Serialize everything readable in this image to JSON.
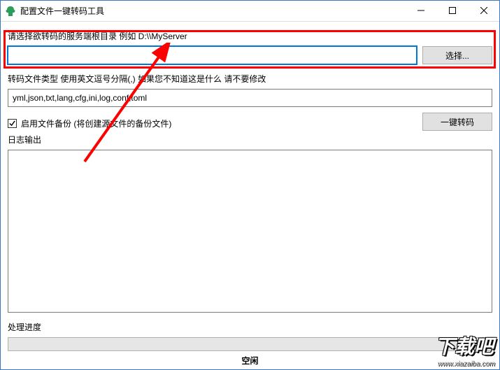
{
  "titlebar": {
    "title": "配置文件一键转码工具",
    "icon_name": "app-icon",
    "icon_color": "#2a9d5a"
  },
  "labels": {
    "root_dir_label": "请选择欲转码的服务端根目录 例如 D:\\\\MyServer",
    "file_types_label": "转码文件类型 使用英文逗号分隔(,) 如果您不知道这是什么 请不要修改",
    "backup_label": "启用文件备份 (将创建源文件的备份文件)",
    "log_label": "日志输出",
    "progress_label": "处理进度"
  },
  "inputs": {
    "root_dir_value": "",
    "file_types_value": "yml,json,txt,lang,cfg,ini,log,conf,toml"
  },
  "buttons": {
    "choose": "选择...",
    "convert": "一键转码"
  },
  "checkbox": {
    "backup_checked": true
  },
  "log_output": "",
  "progress": {
    "status_text": "空闲",
    "percent": 0
  },
  "watermark": {
    "text": "下载吧",
    "url": "www.xiazaiba.com"
  }
}
